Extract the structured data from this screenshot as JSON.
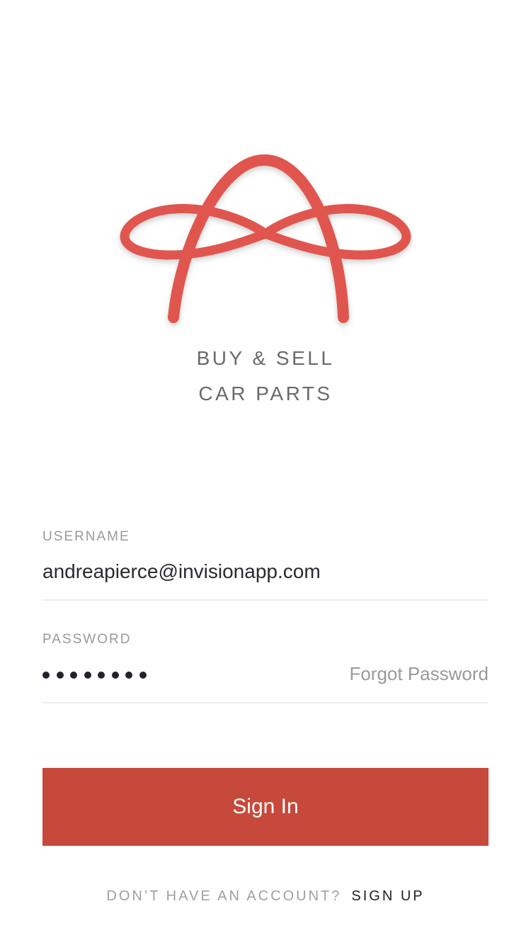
{
  "brand": {
    "logo_color": "#e0564f",
    "tagline_line1": "BUY & SELL",
    "tagline_line2": "CAR PARTS"
  },
  "form": {
    "username_label": "USERNAME",
    "username_value": "andreapierce@invisionapp.com",
    "password_label": "PASSWORD",
    "password_length": 8,
    "forgot_label": "Forgot Password"
  },
  "actions": {
    "signin_label": "Sign In",
    "signin_color": "#c6493b"
  },
  "footer": {
    "question": "DON’T HAVE AN ACCOUNT?",
    "signup_label": "SIGN UP"
  }
}
